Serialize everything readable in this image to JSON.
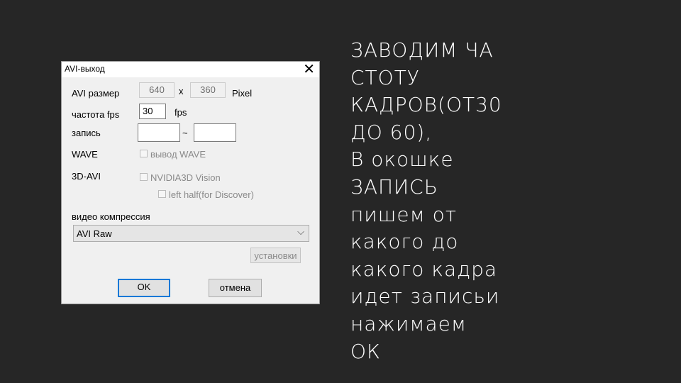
{
  "dialog": {
    "title": "AVI-выход",
    "close_glyph": "✕",
    "size_label": "AVI размер",
    "width_value": "640",
    "x_label": "x",
    "height_value": "360",
    "pixel_label": "Pixel",
    "fps_label": "частота fps",
    "fps_value": "30",
    "fps_unit": "fps",
    "record_label": "запись",
    "record_from": "",
    "record_sep": "~",
    "record_to": "",
    "wave_label": "WAVE",
    "wave_checkbox_label": "вывод WAVE",
    "avi3d_label": "3D-AVI",
    "nvidia_checkbox_label": "NVIDIA3D Vision",
    "left_half_checkbox_label": "left half(for Discover)",
    "compression_label": "видео компрессия",
    "compression_value": "AVI Raw",
    "settings_button": "установки",
    "ok_button": "OK",
    "cancel_button": "отмена"
  },
  "slide": {
    "lines": [
      "ЗАВОДИМ ЧА",
      "СТОТУ",
      "КАДРОВ(ОТ30",
      "ДО 60),",
      "В окошке",
      "ЗАПИСЬ",
      "пишем от",
      "какого до",
      "какого кадра",
      "идет записьи",
      "нажимаем",
      "ОК"
    ]
  }
}
